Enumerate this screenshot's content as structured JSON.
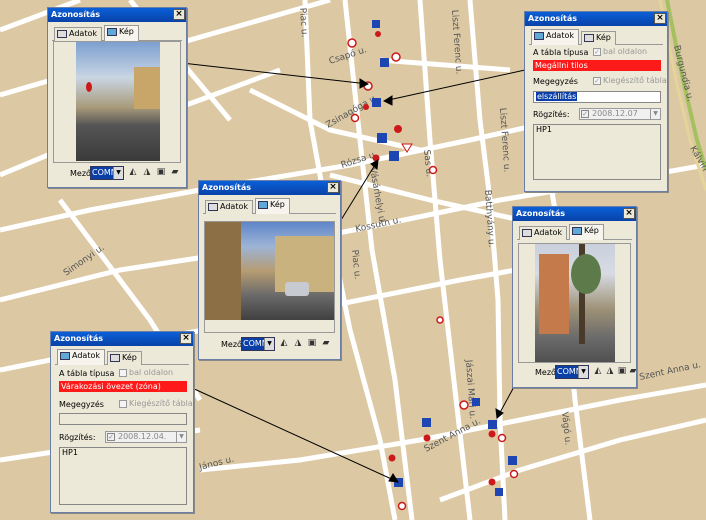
{
  "map": {
    "streets": [
      "Csapó u.",
      "Zsinagóga u.",
      "Rózsa u.",
      "Kossuth u.",
      "Simonyi u.",
      "Piac u.",
      "Piac u.",
      "Vásárhelyi u.",
      "Sas u.",
      "Liszt Ferenc u.",
      "Liszt Ferenc u.",
      "Batthyány u.",
      "Burgundia u.",
      "Kálvin tér",
      "Szent Anna u.",
      "Szent Anna u.",
      "Jászai Mari u.",
      "Vágó u.",
      "János u."
    ]
  },
  "colors": {
    "sign_red": "#cc1a1a",
    "sign_blue": "#1d46b3",
    "highlight": "#ff1a1a"
  },
  "windows": {
    "w1": {
      "title": "Azonosítás",
      "tabs": [
        "Adatok",
        "Kép"
      ],
      "mezo_label": "Mező",
      "mezo_value": "COMN",
      "close": "×"
    },
    "w2": {
      "title": "Azonosítás",
      "tabs": [
        "Adatok",
        "Kép"
      ],
      "tabla_tipusa": "A tábla típusa",
      "bal_oldalon": "bal oldalon",
      "sign_type": "Megállni tilos",
      "megegyzes": "Megegyzés",
      "kiegeszito": "Kiegészítő tábla",
      "value": "elszállítás",
      "rogzites": "Rögzítés:",
      "date": "2008.12.07",
      "code": "HP1",
      "close": "×"
    },
    "w3": {
      "title": "Azonosítás",
      "tabs": [
        "Adatok",
        "Kép"
      ],
      "mezo_label": "Mező",
      "mezo_value": "COMN",
      "close": "×"
    },
    "w4": {
      "title": "Azonosítás",
      "tabs": [
        "Adatok",
        "Kép"
      ],
      "mezo_label": "Mező",
      "mezo_value": "COMN",
      "close": "×"
    },
    "w5": {
      "title": "Azonosítás",
      "tabs": [
        "Adatok",
        "Kép"
      ],
      "tabla_tipusa": "A tábla típusa",
      "bal_oldalon": "bal oldalon",
      "sign_type": "Várakozási övezet (zóna)",
      "megegyzes": "Megegyzés",
      "kiegeszito": "Kiegészítő tábla",
      "rogzites": "Rögzítés:",
      "date": "2008.12.04.",
      "code": "HP1",
      "close": "×"
    }
  }
}
